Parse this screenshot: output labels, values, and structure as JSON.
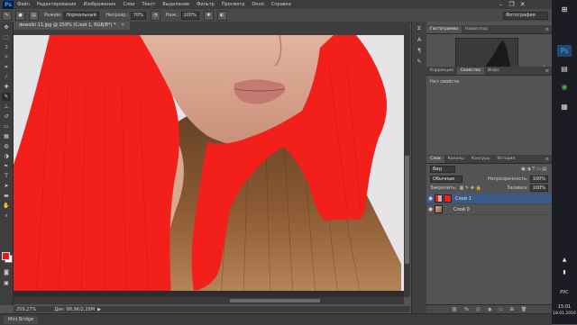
{
  "app": {
    "logo": "Ps"
  },
  "menu": [
    "Файл",
    "Редактирование",
    "Изображение",
    "Слои",
    "Текст",
    "Выделение",
    "Фильтр",
    "Просмотр",
    "Окно",
    "Справка"
  ],
  "options": {
    "mode_label": "Режим:",
    "mode_value": "Нормальный",
    "opacity_label": "Непрозр.:",
    "opacity_value": "70%",
    "flow_label": "Наж.:",
    "flow_value": "100%",
    "workspace": "Фотография"
  },
  "window_controls": {
    "minimize": "–",
    "restore": "❐",
    "close": "✕"
  },
  "document": {
    "tab_title": "dewolki 11.jpg @ 259% (Слой 1, RGB/8*) *",
    "zoom": "259,27%",
    "doc_info": "Док: 98,9K/2,29M"
  },
  "bottom": {
    "mini_bridge": "Mini Bridge"
  },
  "panels": {
    "histogram_tabs": [
      "Гистограмма",
      "Навигатор"
    ],
    "properties_tabs": [
      "Коррекция",
      "Свойства",
      "Инфо"
    ],
    "properties_empty": "Нет свойств",
    "layers_tabs": [
      "Слои",
      "Каналы",
      "Контуры",
      "История"
    ],
    "kind_filter": "Вид",
    "blend_mode": "Обычные",
    "opacity_label": "Непрозрачность:",
    "opacity_value": "100%",
    "lock_label": "Закрепить:",
    "fill_label": "Заливка:",
    "fill_value": "100%",
    "layers": [
      {
        "name": "Слой 1",
        "selected": true
      },
      {
        "name": "Слой 0",
        "selected": false
      }
    ]
  },
  "taskbar": {
    "lang": "РУС",
    "time": "15:01",
    "date": "18.01.2016"
  },
  "colors": {
    "foreground": "#e81b1b",
    "background": "#ffffff",
    "accent": "#3c5a86"
  }
}
